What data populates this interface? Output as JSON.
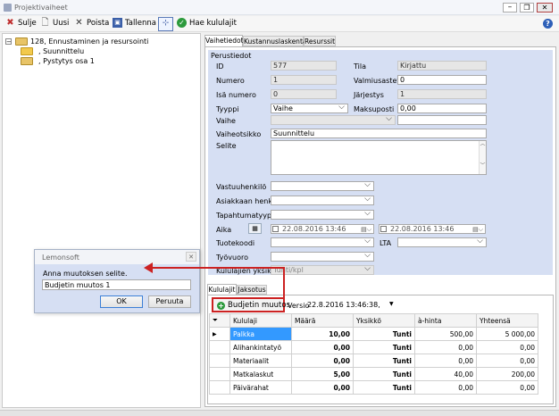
{
  "window": {
    "title": "Projektivaiheet"
  },
  "toolbar": {
    "close_label": "Sulje",
    "new_label": "Uusi",
    "delete_label": "Poista",
    "save_label": "Tallenna",
    "fetch_label": "Hae kululajit"
  },
  "tree": {
    "root": "128, Ennustaminen ja resursointi",
    "children": [
      ", Suunnittelu",
      ", Pystytys osa 1"
    ]
  },
  "tabs": [
    "Vaihetiedot",
    "Kustannuslaskenta",
    "Resurssit"
  ],
  "section": {
    "title": "Perustiedot"
  },
  "form": {
    "id_label": "ID",
    "id_value": "577",
    "number_label": "Numero",
    "number_value": "1",
    "parent_label": "Isä numero",
    "parent_value": "0",
    "type_label": "Tyyppi",
    "type_value": "Vaihe",
    "phase_label": "Vaihe",
    "phase_value": "",
    "title_label": "Vaiheotsikko",
    "title_value": "Suunnittelu",
    "desc_label": "Selite",
    "status_label": "Tila",
    "status_value": "Kirjattu",
    "completion_label": "Valmiusaste%",
    "completion_value": "0",
    "order_label": "Järjestys",
    "order_value": "1",
    "payment_label": "Maksuposti",
    "payment_value": "0,00",
    "responsible_label": "Vastuuhenkilö",
    "customer_label": "Asiakkaan henk.",
    "event_type_label": "Tapahtumatyyppi",
    "time_label": "Aika",
    "date_start": "22.08.2016 13:46",
    "date_end": "22.08.2016 13:46",
    "product_code_label": "Tuotekoodi",
    "lta_label": "LTA",
    "work_label": "Työvuoro",
    "unit_label": "Kululajien yksikkö",
    "unit_value": "Tunti/kpl"
  },
  "subtabs": [
    "Kululajit",
    "Jaksotus"
  ],
  "budget": {
    "button_label": "Budjetin muutos",
    "version_label": "Versio",
    "version_value": "22.8.2016 13:46:38,"
  },
  "grid": {
    "columns": [
      "Kululaji",
      "Määrä",
      "Yksikkö",
      "à-hinta",
      "Yhteensä"
    ],
    "rows": [
      {
        "name": "Palkka",
        "qty": "10,00",
        "unit": "Tunti",
        "price": "500,00",
        "total": "5 000,00"
      },
      {
        "name": "Alihankintatyö",
        "qty": "0,00",
        "unit": "Tunti",
        "price": "0,00",
        "total": "0,00"
      },
      {
        "name": "Materiaalit",
        "qty": "0,00",
        "unit": "Tunti",
        "price": "0,00",
        "total": "0,00"
      },
      {
        "name": "Matkalaskut",
        "qty": "5,00",
        "unit": "Tunti",
        "price": "40,00",
        "total": "200,00"
      },
      {
        "name": "Päivärahat",
        "qty": "0,00",
        "unit": "Tunti",
        "price": "0,00",
        "total": "0,00"
      }
    ]
  },
  "dialog": {
    "title": "Lemonsoft",
    "prompt": "Anna muutoksen selite.",
    "input_value": "Budjetin muutos 1",
    "ok_label": "OK",
    "cancel_label": "Peruuta"
  },
  "colors": {
    "panel_blue": "#d6dff3",
    "highlight": "#cc2222",
    "selection": "#3399ff"
  }
}
